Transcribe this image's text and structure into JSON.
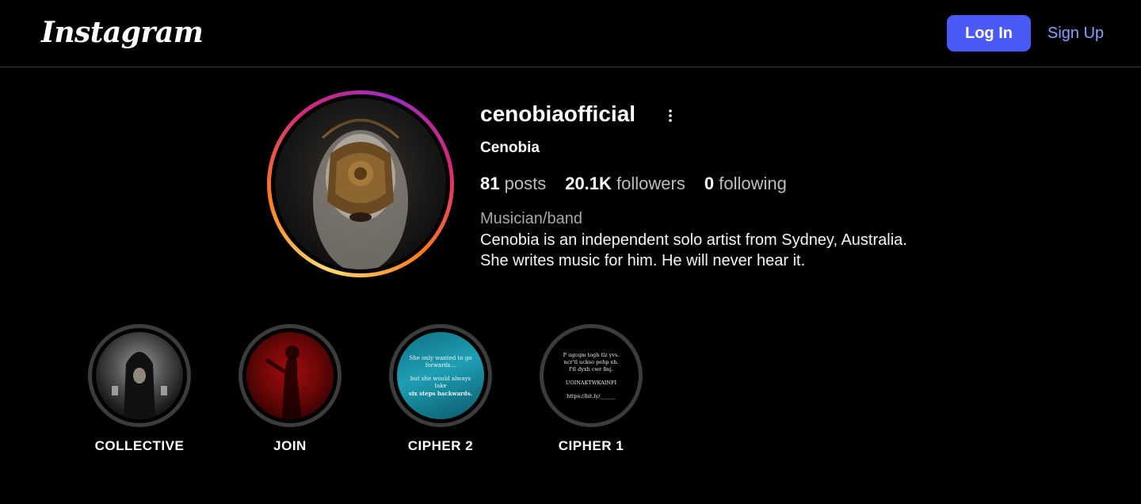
{
  "header": {
    "logo_text": "Instagram",
    "login_label": "Log In",
    "signup_label": "Sign Up",
    "accent_color": "#4a5bf5"
  },
  "profile": {
    "username": "cenobiaofficial",
    "full_name": "Cenobia",
    "stats": [
      {
        "value": "81",
        "label": "posts"
      },
      {
        "value": "20.1K",
        "label": "followers"
      },
      {
        "value": "0",
        "label": "following"
      }
    ],
    "category": "Musician/band",
    "bio": "Cenobia is an independent solo artist from Sydney, Australia. She writes music for him. He will never hear it.",
    "more_icon": "more-horizontal-icon"
  },
  "highlights": [
    {
      "label": "COLLECTIVE"
    },
    {
      "label": "JOIN"
    },
    {
      "label": "CIPHER 2",
      "cover_lines": [
        "She only wanted to go forwards...",
        "but she would always take",
        "six steps backwards."
      ]
    },
    {
      "label": "CIPHER 1",
      "cover_lines": [
        "P ugcqm togh tlz yvs.",
        "ncr'tl uckso pehp xh.",
        "f'tl dyxh cwr fmj.",
        "UOINAKTWKAINFI",
        "https://bit.ly/______"
      ]
    }
  ]
}
